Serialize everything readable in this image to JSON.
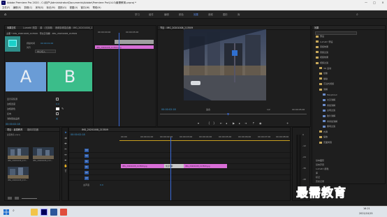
{
  "window": {
    "title": "Adobe Premiere Pro 2020 - C:\\用户\\Administrator\\Documents\\Adobe\\Premiere Pro\\14.0\\最需教育.prproj *",
    "app_icon": "Pr"
  },
  "menu": [
    "文件(F)",
    "编辑(E)",
    "剪辑(C)",
    "序列(S)",
    "标记(M)",
    "图形(G)",
    "视图(V)",
    "窗口(W)",
    "帮助(H)"
  ],
  "workspaces": [
    "学习",
    "组件",
    "编辑",
    "颜色",
    "效果",
    "音频",
    "图形",
    "库"
  ],
  "active_workspace": "效果",
  "effect_controls": {
    "tabs": [
      "效果控件",
      "Lumetri 范围",
      "源：(无剪辑)",
      "音频剪辑混合器：IMG_20201008_213509"
    ],
    "header": "主要 * IMG_20201008_213509 · 带交叉溶解 · IMG_20201008_213509",
    "props": [
      {
        "label": "持续时间",
        "value": "00:00:01:00"
      },
      {
        "label": "对齐",
        "value": "中心切入"
      }
    ],
    "lower_props": [
      "显示实际源",
      "边框宽度",
      "边框颜色",
      "反向",
      "消除锯齿品质"
    ],
    "lower_values": [
      "0.0",
      "",
      "",
      "",
      "关"
    ],
    "preview_a": "A",
    "preview_b": "B",
    "timecode": "00:00:02:18"
  },
  "mini_timeline": {
    "clip_label": "IMG_20201008_213509.jpg",
    "time_a": "00:00:00:00",
    "time_b": "00:00:05:00"
  },
  "program": {
    "tab": "节目：IMG_20201008_213509",
    "timecode_left": "00:00:02:18",
    "fit": "适合",
    "quality": "1/2",
    "timecode_right": "00:00:05:00"
  },
  "effects": {
    "tab": "效果",
    "tree": [
      "预设",
      "Lumetri 预设",
      "音频效果",
      "音频过渡",
      "视频效果",
      "视频过渡",
      "3D 运动",
      "划像",
      "擦除",
      "沉浸式视频",
      "溶解",
      "MorphCut",
      "交叉溶解",
      "叠加溶解",
      "白场过渡",
      "胶片溶解",
      "非叠加溶解",
      "黑场过渡",
      "内滑",
      "缩放",
      "页面剥落"
    ],
    "lower_tabs": [
      "基本图形",
      "基本声音",
      "Lumetri 颜色",
      "库",
      "标记",
      "历史记录",
      "信息"
    ]
  },
  "project": {
    "tabs": [
      "项目：最需教育",
      "媒体浏览器"
    ],
    "file": "最需教育.prproj",
    "items": [
      {
        "name": "IMG_20201008_213...",
        "dur": "5:00"
      },
      {
        "name": "IMG_20201008_213...",
        "dur": "5:00"
      },
      {
        "name": "IMG_20201008_213...",
        "dur": "5:00"
      }
    ]
  },
  "sequence": {
    "tab": "IMG_20201008_213509",
    "timecode": "00:00:02:18",
    "ruler": [
      "00:00",
      "00:00:01:00",
      "00:00:02:00",
      "00:00:03:00",
      "00:00:04:00",
      "00:00:05:00",
      "00:00:06:00",
      "00:00:07:00",
      "00:00:08:00"
    ],
    "tracks": [
      "V3",
      "V2",
      "V1",
      "A1",
      "A2",
      "A3"
    ],
    "master": "主声道",
    "master_value": "0.0",
    "clip1": "IMG_20201008_213509.jpg",
    "clip2": "IMG_20201008_213509.jpg",
    "transition": "交叉溶解"
  },
  "meters": {
    "scale": [
      "0",
      "-12",
      "-24",
      "-36",
      "-48",
      "dB"
    ]
  },
  "taskbar": {
    "time": "16:21",
    "date": "2021/10/15"
  },
  "watermark": "最需教育",
  "colors": {
    "accent": "#5c8ef0",
    "clip_pink": "#d86ed6",
    "timecode_blue": "#3a9bd9"
  }
}
